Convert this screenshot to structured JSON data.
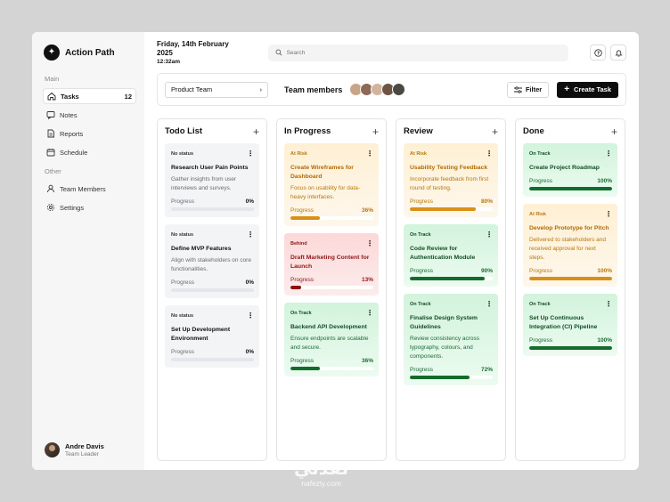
{
  "brand": {
    "title": "Action Path"
  },
  "sidebar": {
    "main_label": "Main",
    "main_items": [
      {
        "label": "Tasks",
        "icon": "home-icon",
        "count": "12",
        "active": true
      },
      {
        "label": "Notes",
        "icon": "notes-icon"
      },
      {
        "label": "Reports",
        "icon": "reports-icon"
      },
      {
        "label": "Schedule",
        "icon": "calendar-icon"
      }
    ],
    "other_label": "Other",
    "other_items": [
      {
        "label": "Team Members",
        "icon": "user-icon"
      },
      {
        "label": "Settings",
        "icon": "gear-icon"
      }
    ],
    "user": {
      "name": "Andre Davis",
      "role": "Team Leader"
    }
  },
  "header": {
    "date": "Friday, 14th February 2025",
    "time": "12:32am",
    "search_placeholder": "Search"
  },
  "toolbar": {
    "team_select": "Product Team",
    "team_label": "Team members",
    "filter_label": "Filter",
    "create_label": "Create Task"
  },
  "progress_label": "Progress",
  "columns": [
    {
      "title": "Todo List",
      "cards": [
        {
          "status": "No status",
          "title": "Research User Pain Points",
          "desc": "Gather insights from user interviews and surveys.",
          "progress": "0%",
          "pct": 0,
          "tone": "gray"
        },
        {
          "status": "No status",
          "title": "Define MVP Features",
          "desc": "Align with stakeholders on core functionalities.",
          "progress": "0%",
          "pct": 0,
          "tone": "gray"
        },
        {
          "status": "No status",
          "title": "Set Up Development Environment",
          "desc": "",
          "progress": "0%",
          "pct": 0,
          "tone": "gray"
        }
      ]
    },
    {
      "title": "In Progress",
      "cards": [
        {
          "status": "At Risk",
          "title": "Create Wireframes for Dashboard",
          "desc": "Focus on usability for data-heavy interfaces.",
          "progress": "36%",
          "pct": 36,
          "tone": "amber"
        },
        {
          "status": "Behind",
          "title": "Draft Marketing Content for Launch",
          "desc": "",
          "progress": "13%",
          "pct": 13,
          "tone": "red"
        },
        {
          "status": "On Track",
          "title": "Backend API Development",
          "desc": "Ensure endpoints are scalable and secure.",
          "progress": "36%",
          "pct": 36,
          "tone": "green"
        }
      ]
    },
    {
      "title": "Review",
      "cards": [
        {
          "status": "At Risk",
          "title": "Usability Testing Feedback",
          "desc": "Incorporate feedback from first round of testing.",
          "progress": "80%",
          "pct": 80,
          "tone": "amber"
        },
        {
          "status": "On Track",
          "title": "Code Review for Authentication Module",
          "desc": "",
          "progress": "90%",
          "pct": 90,
          "tone": "green"
        },
        {
          "status": "On Track",
          "title": "Finalise Design System Guidelines",
          "desc": "Review consistency across typography, colours, and components.",
          "progress": "72%",
          "pct": 72,
          "tone": "green"
        }
      ]
    },
    {
      "title": "Done",
      "cards": [
        {
          "status": "On Track",
          "title": "Create Project Roadmap",
          "desc": "",
          "progress": "100%",
          "pct": 100,
          "tone": "green"
        },
        {
          "status": "At Risk",
          "title": "Develop Prototype for Pitch",
          "desc": "Delivered to stakeholders and received approval for next steps.",
          "progress": "100%",
          "pct": 100,
          "tone": "amber"
        },
        {
          "status": "On Track",
          "title": "Set Up Continuous Integration (CI) Pipeline",
          "desc": "",
          "progress": "100%",
          "pct": 100,
          "tone": "green"
        }
      ]
    }
  ],
  "watermark": {
    "arabic": "نفذلي",
    "latin": "nafezly.com"
  },
  "colors": {
    "accent": "#0d0d0d",
    "at_risk": "#d99014",
    "behind": "#8b0f0f",
    "on_track": "#146c2c"
  }
}
